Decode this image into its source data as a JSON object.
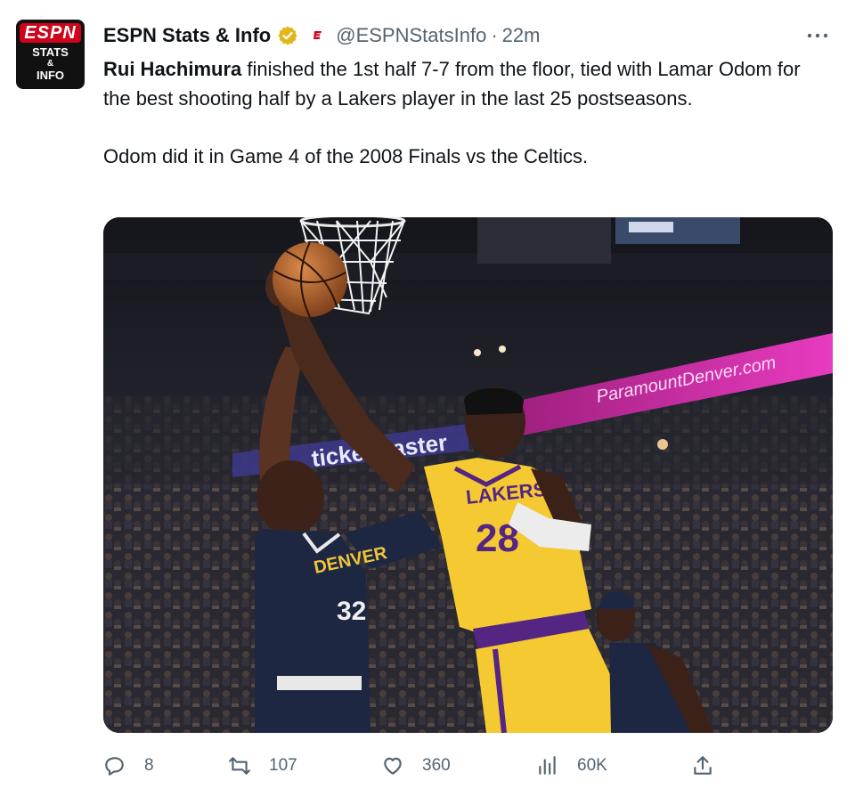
{
  "tweet": {
    "author": {
      "name": "ESPN Stats & Info",
      "handle": "@ESPNStatsInfo",
      "separator": "·",
      "time": "22m",
      "avatar": {
        "logo_text": "ESPN",
        "line1": "STATS",
        "line2": "&",
        "line3": "INFO"
      }
    },
    "text": {
      "mention": "Rui Hachimura",
      "rest": " finished the 1st half 7-7 from the floor, tied with Lamar Odom for the best shooting half by a Lakers player in the last 25 postseasons.",
      "para2": "Odom did it in Game 4 of the 2008 Finals vs the Celtics."
    },
    "media": {
      "arena_sign_right": "ParamountDenver.com",
      "arena_sign_left": "ticketmaster",
      "jersey_lakers_text": "LAKERS",
      "jersey_lakers_number": "28",
      "jersey_nuggets_text": "DENVER",
      "jersey_nuggets_number": "32"
    },
    "actions": {
      "replies": "8",
      "reposts": "107",
      "likes": "360",
      "views": "60K"
    },
    "colors": {
      "verified_gold": "#e2b719",
      "espn_red": "#d0021b",
      "muted": "#536471",
      "lakers_gold": "#f5c932",
      "lakers_purple": "#552583",
      "nuggets_navy": "#1d2742"
    },
    "icons": [
      "more-icon",
      "verified-icon",
      "affiliate-icon",
      "reply-icon",
      "repost-icon",
      "like-icon",
      "views-icon",
      "share-icon"
    ]
  }
}
